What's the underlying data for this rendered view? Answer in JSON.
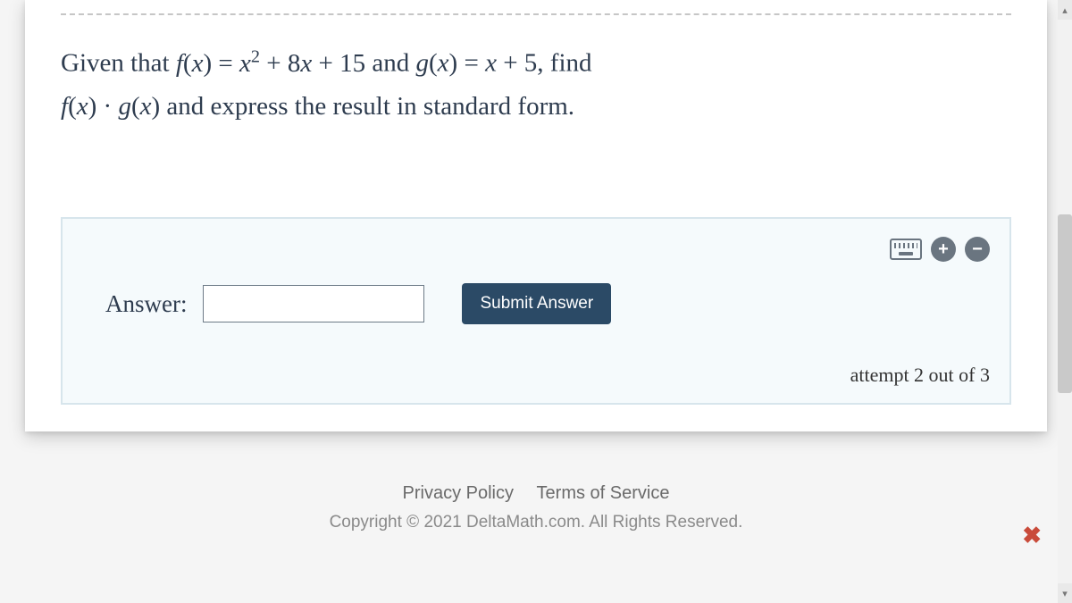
{
  "question": {
    "prefix": "Given that ",
    "f_expr": "f(x) = x² + 8x + 15",
    "mid1": " and ",
    "g_expr": "g(x) = x + 5",
    "mid2": ", find ",
    "product_expr": "f(x) · g(x)",
    "suffix": " and express the result in standard form."
  },
  "answer": {
    "label": "Answer:",
    "value": "",
    "submit": "Submit Answer",
    "attempt": "attempt 2 out of 3"
  },
  "tools": {
    "plus": "+",
    "minus": "−"
  },
  "footer": {
    "privacy": "Privacy Policy",
    "terms": "Terms of Service",
    "copyright": "Copyright © 2021 DeltaMath.com. All Rights Reserved."
  },
  "close": "✖",
  "scroll": {
    "up": "▴",
    "down": "▾"
  }
}
